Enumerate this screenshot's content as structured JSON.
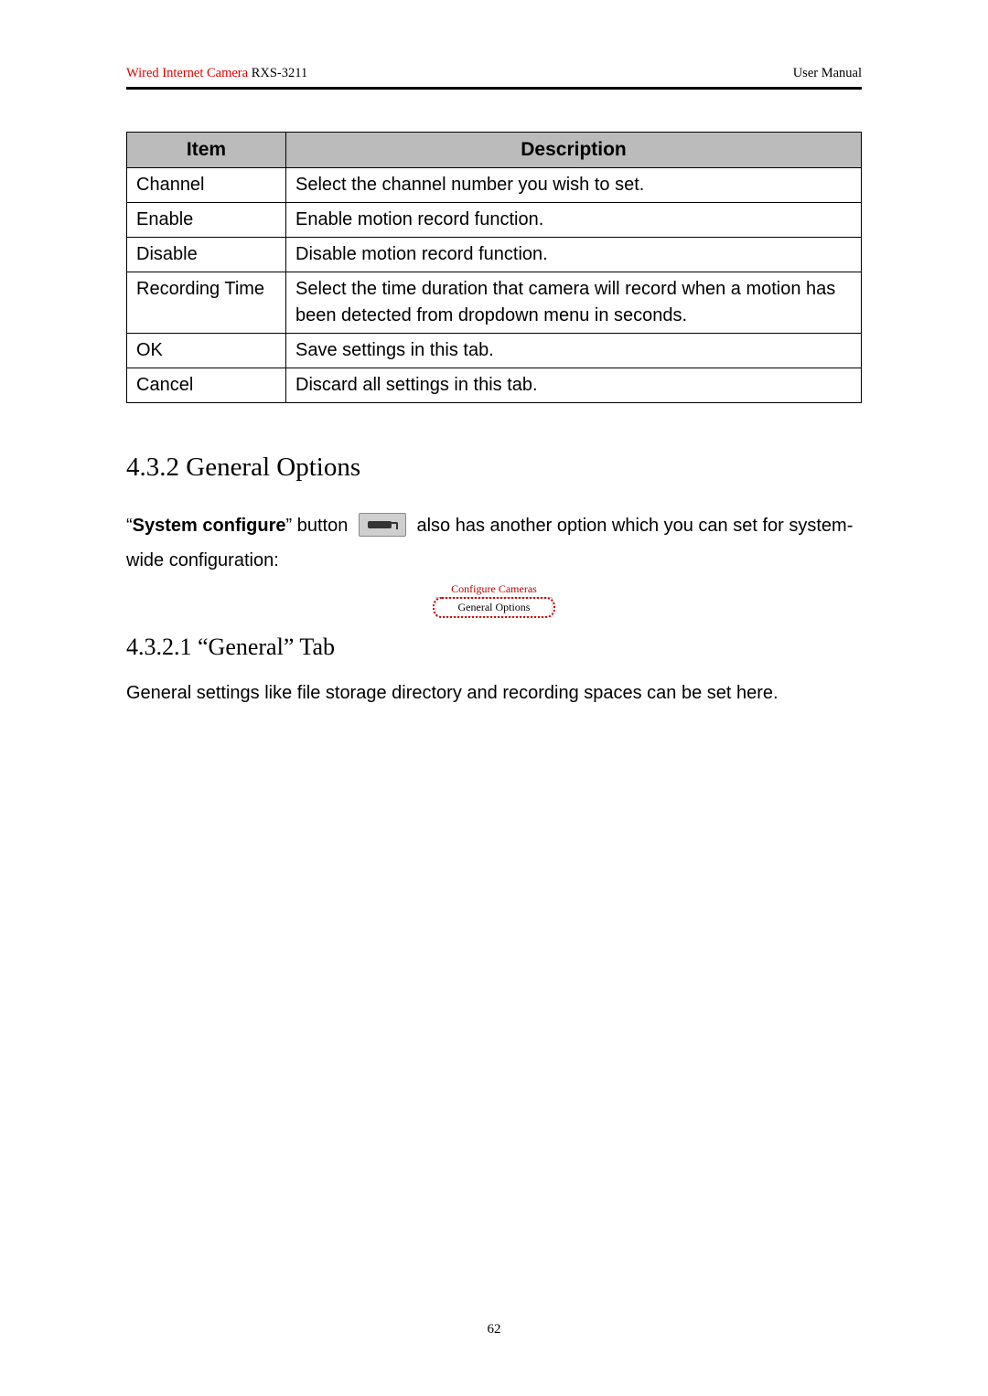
{
  "header": {
    "left_red": "Wired Internet Camera",
    "left_model": " RXS-3211",
    "right": "User Manual"
  },
  "table": {
    "headers": {
      "item": "Item",
      "description": "Description"
    },
    "rows": [
      {
        "item": "Channel",
        "desc": "Select the channel number you wish to set."
      },
      {
        "item": "Enable",
        "desc": "Enable motion record function."
      },
      {
        "item": "Disable",
        "desc": "Disable motion record function."
      },
      {
        "item": "Recording Time",
        "desc": "Select the time duration that camera will record when a motion has been detected from dropdown menu in seconds."
      },
      {
        "item": "OK",
        "desc": "Save settings in this tab."
      },
      {
        "item": "Cancel",
        "desc": "Discard all settings in this tab."
      }
    ]
  },
  "section": {
    "heading": "4.3.2 General Options",
    "para_prefix_quote": "“",
    "para_bold": "System configure",
    "para_after_bold": "” button ",
    "para_after_icon": " also has another option which you can set for system-wide configuration:",
    "menu_line1": "Configure Cameras",
    "menu_line2": "General Options"
  },
  "subsection": {
    "heading": "4.3.2.1 “General” Tab",
    "para": "General settings like file storage directory and recording spaces can be set here."
  },
  "page_number": "62"
}
